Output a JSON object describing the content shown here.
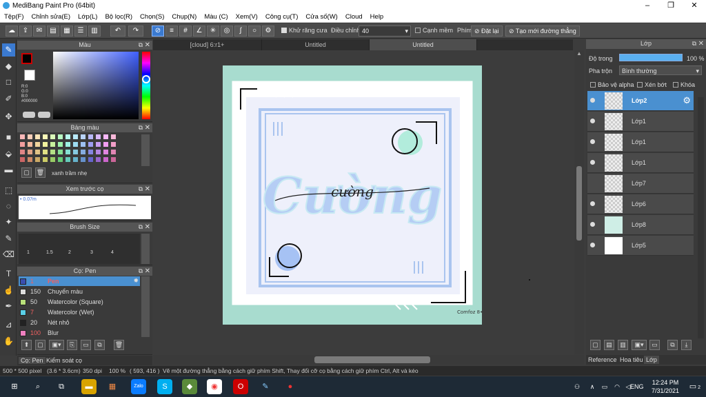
{
  "window": {
    "title": "MediBang Paint Pro (64bit)"
  },
  "menu": [
    "Tệp(F)",
    "Chỉnh sửa(E)",
    "Lớp(L)",
    "Bộ lọc(R)",
    "Chọn(S)",
    "Chụp(N)",
    "Màu (C)",
    "Xem(V)",
    "Công cụ(T)",
    "Cửa số(W)",
    "Cloud",
    "Help"
  ],
  "toolbar": {
    "antialias": "Khử răng cưa",
    "adjust_label": "Điều chỉnh",
    "adjust_value": "40",
    "edge": "Cạnh mềm",
    "key_label": "Phím",
    "set_btn": "Đặt lại",
    "line_btn": "Tạo mới đường thẳng"
  },
  "tabs": [
    "[cloud] 6:r1+",
    "Untitled",
    "Untitled"
  ],
  "color_panel": {
    "title": "Màu",
    "r": "R:0",
    "g": "G:0",
    "b": "B:0",
    "hex": "#000000"
  },
  "palette_panel": {
    "title": "Bảng màu",
    "name": "xanh trầm nhẹ"
  },
  "preview_panel": {
    "title": "Xem trước cọ",
    "size": "0.07m"
  },
  "brushsize_panel": {
    "title": "Brush Size",
    "sizes": [
      "1",
      "1.5",
      "2",
      "3",
      "4"
    ]
  },
  "brush_panel": {
    "title": "Cọ: Pen",
    "brushes": [
      {
        "size": "1",
        "name": "Pen",
        "color": "#3a4fb0"
      },
      {
        "size": "150",
        "name": "Chuyển màu",
        "color": "#dddddd"
      },
      {
        "size": "50",
        "name": "Watercolor (Square)",
        "color": "#b8e07a"
      },
      {
        "size": "7",
        "name": "Watercolor (Wet)",
        "color": "#5ad0e8"
      },
      {
        "size": "20",
        "name": "Nét nhỏ",
        "color": "#222222"
      },
      {
        "size": "100",
        "name": "Blur",
        "color": "#f080c0"
      }
    ]
  },
  "bottom_left_tabs": [
    "Cọ: Pen",
    "Kiểm soát cọ"
  ],
  "layer_panel": {
    "title": "Lớp",
    "opacity_label": "Độ trong",
    "opacity_value": "100 %",
    "blend_label": "Pha trộn",
    "blend_value": "Bình thường",
    "protect_alpha": "Bảo vệ alpha",
    "clip": "Xén bớt",
    "lock": "Khóa"
  },
  "layers": [
    "Lớp2",
    "Lớp1",
    "Lớp1",
    "Lớp1",
    "Lớp7",
    "Lớp6",
    "Lớp8",
    "Lớp5"
  ],
  "right_tabs": [
    "Reference",
    "Hoa tiêu",
    "Lớp"
  ],
  "artwork": {
    "text": "Cường",
    "overlay": "cường",
    "signature": "Comfoz\n8•17•17"
  },
  "status": {
    "size": "500 * 500 pixel",
    "dims": "(3.6 * 3.6cm)",
    "dpi": "350 dpi",
    "zoom": "100 %",
    "pos": "( 593, 416 )",
    "hint": "Vẽ một đường thẳng bằng cách giữ phím Shift, Thay đổi cỡ cọ bằng cách giữ phím Ctrl, Alt và kéo"
  },
  "taskbar": {
    "lang": "ENG",
    "time": "12:24 PM",
    "date": "7/31/2021",
    "notif": "2"
  },
  "colors": {
    "accent": "#3b7ad0",
    "selected_layer": "#4a90d0",
    "frame_green": "#a8dccf"
  }
}
